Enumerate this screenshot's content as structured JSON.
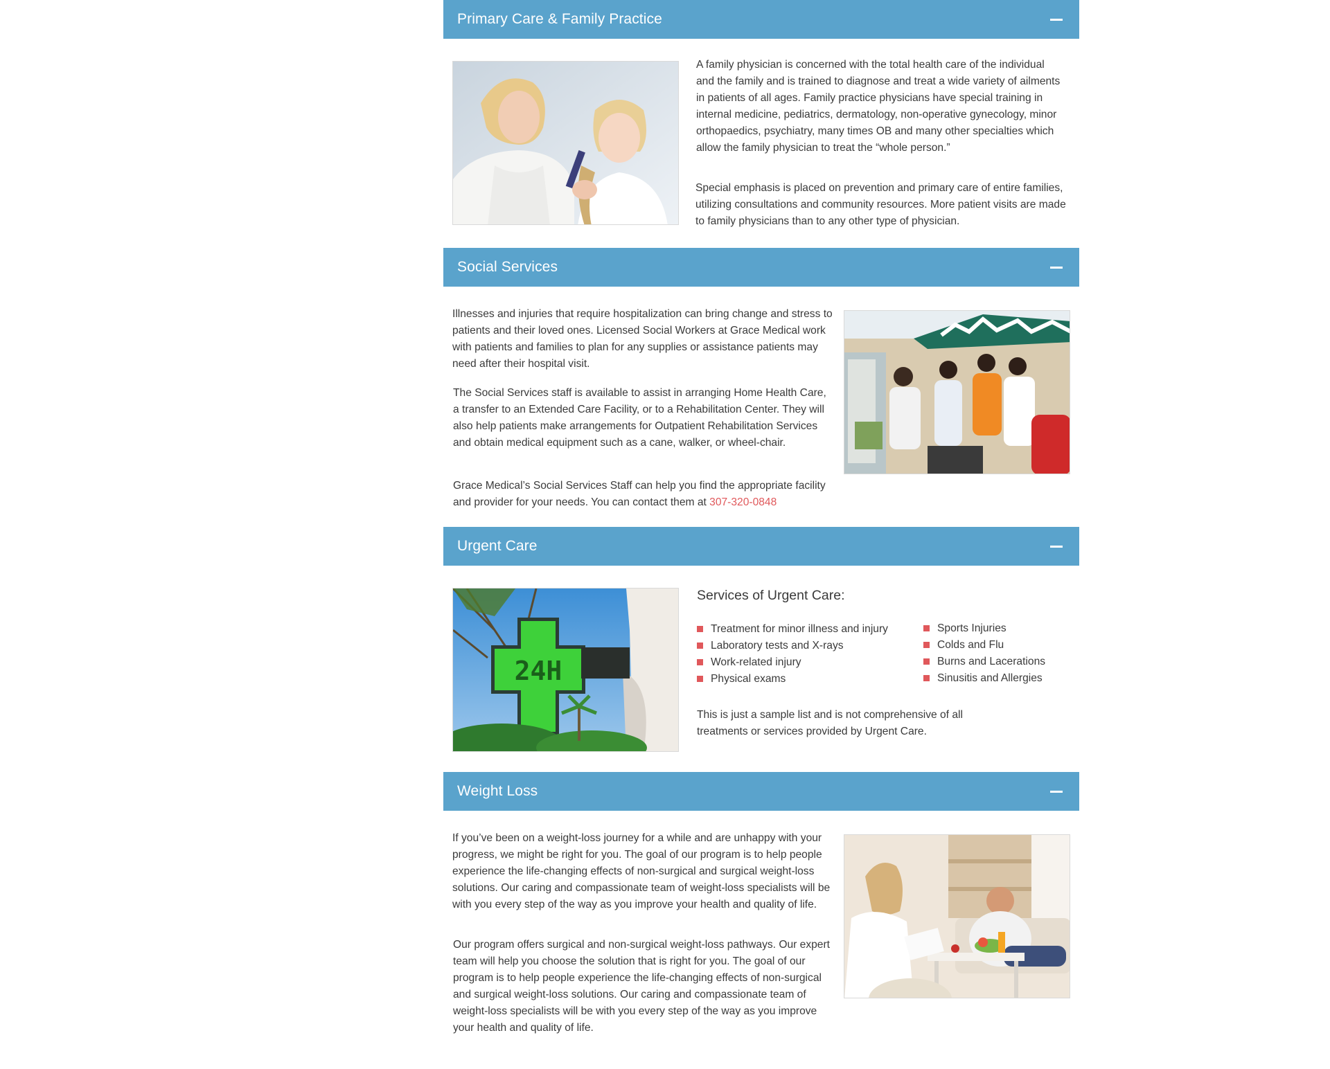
{
  "sections": [
    {
      "title": "Primary Care & Family Practice",
      "image_alt": "Older woman combing a young girl's hair",
      "paragraphs": [
        "A family physician is concerned with the total health care of the individual and the family and is trained to diagnose and treat a wide variety of ailments in patients of all ages. Family practice physicians have special training in internal medicine, pediatrics, dermatology, non-operative gynecology, minor orthopaedics, psychiatry, many times OB and many other specialties which allow the family physician to treat the “whole person.”",
        "Special emphasis is placed on prevention and primary care of entire families, utilizing consultations and community resources. More patient visits are made to family physicians than to any other type of physician."
      ]
    },
    {
      "title": "Social Services",
      "image_alt": "Group of people at an outdoor community event under tents",
      "paragraphs": [
        "Illnesses and injuries that require hospitalization can bring change and stress to patients and their loved ones. Licensed Social Workers at Grace Medical work with patients and families to plan for any supplies or assistance patients may need after their hospital visit.",
        "The Social Services staff is available to assist in arranging Home Health Care, a transfer to an Extended Care Facility, or to a Rehabilitation Center. They will also help patients make arrangements for Outpatient Rehabilitation Services and obtain medical equipment such as a cane, walker, or wheel-chair."
      ],
      "contact_text": "Grace Medical’s Social Services Staff can help you find the appropriate facility and provider for your needs. You can contact them at ",
      "phone": "307-320-0848"
    },
    {
      "title": "Urgent Care",
      "image_alt": "Green 24H pharmacy cross sign among palm trees",
      "image_sign_text": "24H",
      "services_heading": "Services of Urgent Care:",
      "services_left": [
        "Treatment for minor illness and injury",
        "Laboratory tests and X-rays",
        "Work-related injury",
        "Physical exams"
      ],
      "services_right": [
        "Sports Injuries",
        "Colds and Flu",
        "Burns and Lacerations",
        "Sinusitis and Allergies"
      ],
      "note": "This is just a sample list and is not comprehensive of all treatments or services provided by Urgent Care."
    },
    {
      "title": "Weight Loss",
      "image_alt": "Doctor consulting with a patient in a bright room",
      "paragraphs": [
        "If you’ve been on a weight-loss journey for a while and are unhappy with your progress, we might be right for you. The goal of our program is to help people experience the life-changing effects of non-surgical and surgical weight-loss solutions. Our caring and compassionate team of weight-loss specialists will be with you every step of the way as you improve your health and quality of life.",
        "Our program offers surgical and non-surgical weight-loss pathways. Our expert team will help you choose the solution that is right for you. The goal of our program is to help people experience the life-changing effects of non-surgical and surgical weight-loss solutions. Our caring and compassionate team of weight-loss specialists will be with you every step of the way as you improve your health and quality of life."
      ]
    }
  ],
  "colors": {
    "header_bg": "#5aa3cc",
    "header_text": "#ffffff",
    "body_text": "#3a3a3a",
    "accent": "#e0585b"
  },
  "icons": {
    "collapse": "minus-icon",
    "bullet": "square-bullet-icon"
  }
}
